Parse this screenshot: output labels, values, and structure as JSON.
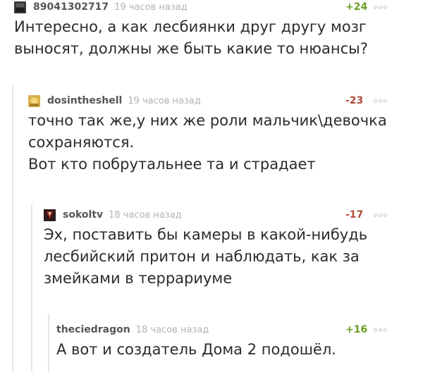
{
  "comments": [
    {
      "user": "89041302717",
      "time": "19 часов назад",
      "rating": "+24",
      "lines": [
        "Интересно, а как лесбиянки друг другу мозг",
        "выносят, должны же быть какие то нюансы?"
      ]
    },
    {
      "user": "dosintheshell",
      "time": "19 часов назад",
      "rating": "-23",
      "lines": [
        "точно так же,у них же роли мальчик\\девочка",
        "сохраняются.",
        "Вот кто побрутальнее та и страдает"
      ]
    },
    {
      "user": "sokoltv",
      "time": "18 часов назад",
      "rating": "-17",
      "lines": [
        "Эх, поставить бы камеры в какой-нибудь",
        "лесбийский притон и наблюдать, как за",
        "змейками в террариуме"
      ]
    },
    {
      "user": "theciedragon",
      "time": "18 часов назад",
      "rating": "+16",
      "lines": [
        "А вот и создатель Дома 2 подошёл."
      ]
    }
  ],
  "colors": {
    "positive": "#6a9e23",
    "negative": "#b14a39"
  },
  "icons": [
    "avatar-image",
    "more-options-icon"
  ]
}
